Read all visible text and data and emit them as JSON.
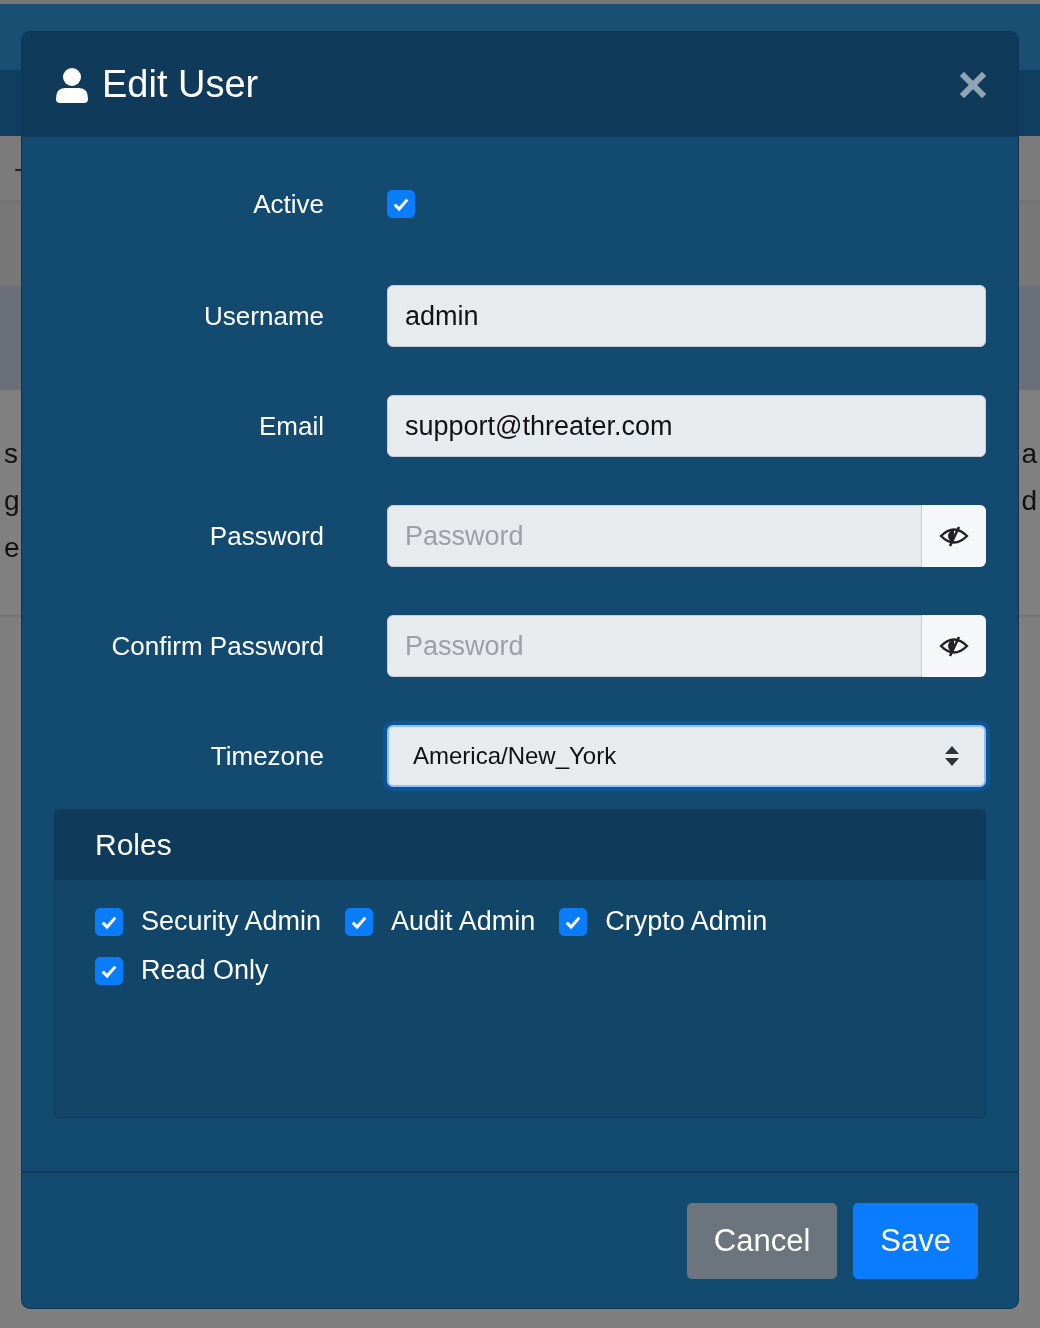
{
  "background": {
    "row_text": "-",
    "left_lines": [
      "s",
      "g",
      "e"
    ],
    "right_lines": [
      "a",
      "d"
    ]
  },
  "dialog": {
    "title": "Edit User",
    "fields": [
      {
        "kind": "checkbox",
        "label": "Active",
        "checked": true
      },
      {
        "kind": "text",
        "label": "Username",
        "value": "admin"
      },
      {
        "kind": "text",
        "label": "Email",
        "value": "support@threater.com"
      },
      {
        "kind": "password",
        "label": "Password",
        "placeholder": "Password"
      },
      {
        "kind": "password",
        "label": "Confirm Password",
        "placeholder": "Password"
      },
      {
        "kind": "select",
        "label": "Timezone",
        "value": "America/New_York"
      }
    ],
    "roles": {
      "title": "Roles",
      "items": [
        {
          "label": "Security Admin",
          "checked": true
        },
        {
          "label": "Audit Admin",
          "checked": true
        },
        {
          "label": "Crypto Admin",
          "checked": true
        },
        {
          "label": "Read Only",
          "checked": true
        }
      ]
    },
    "buttons": [
      {
        "kind": "secondary",
        "label": "Cancel"
      },
      {
        "kind": "primary",
        "label": "Save"
      }
    ]
  }
}
